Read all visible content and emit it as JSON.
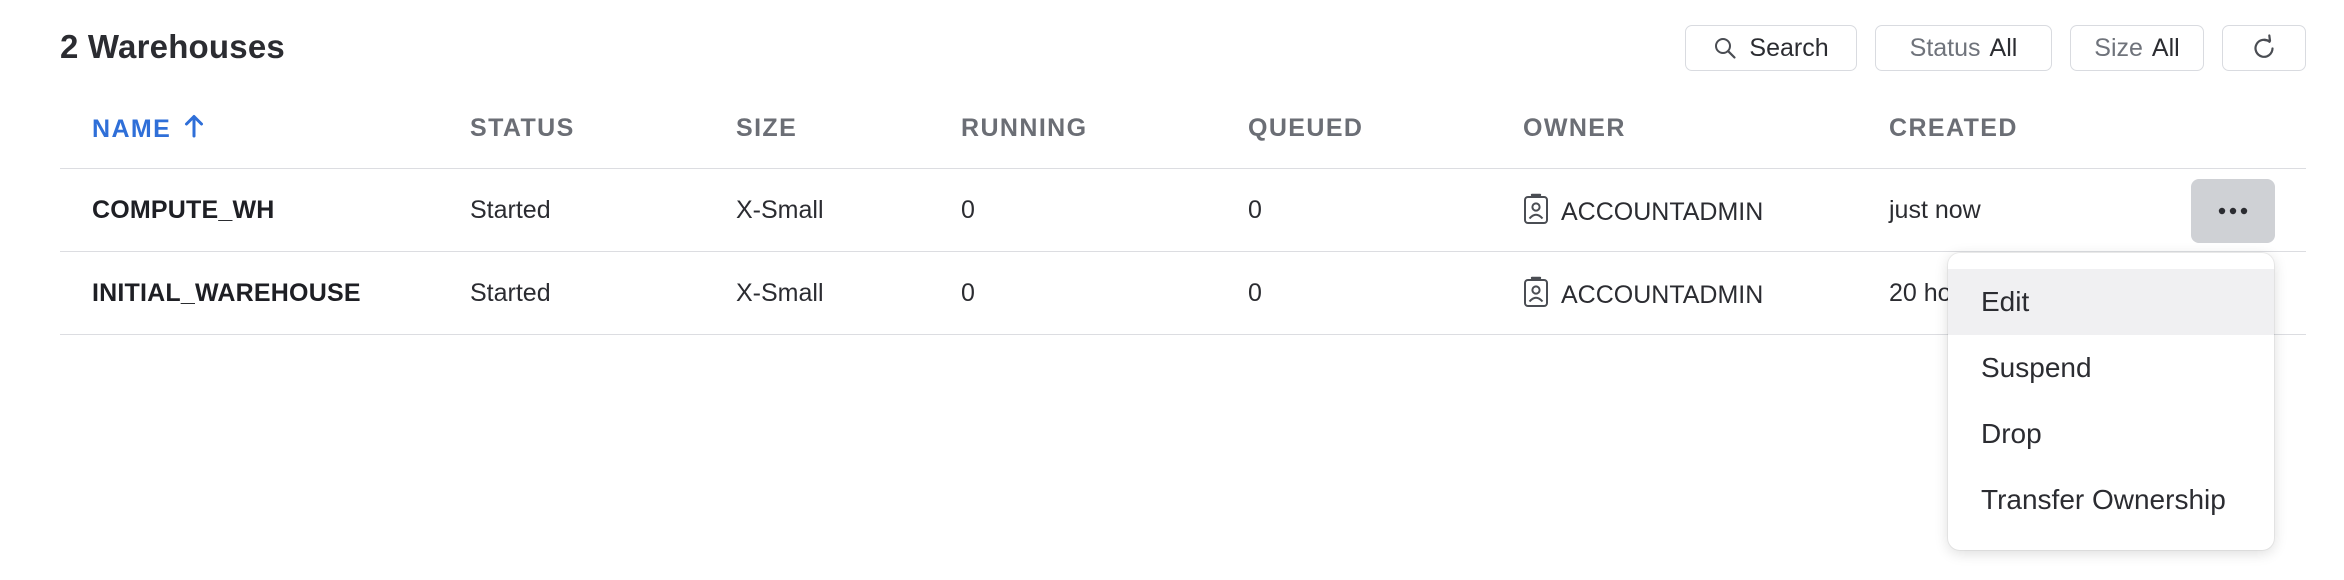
{
  "page": {
    "title": "2 Warehouses"
  },
  "toolbar": {
    "search_label": "Search",
    "status_label": "Status",
    "status_value": "All",
    "size_label": "Size",
    "size_value": "All"
  },
  "table": {
    "headers": {
      "name": "NAME",
      "status": "STATUS",
      "size": "SIZE",
      "running": "RUNNING",
      "queued": "QUEUED",
      "owner": "OWNER",
      "created": "CREATED"
    },
    "sort": {
      "column": "name",
      "direction": "ascending"
    },
    "rows": [
      {
        "name": "COMPUTE_WH",
        "status": "Started",
        "size": "X-Small",
        "running": "0",
        "queued": "0",
        "owner": "ACCOUNTADMIN",
        "created": "just now"
      },
      {
        "name": "INITIAL_WAREHOUSE",
        "status": "Started",
        "size": "X-Small",
        "running": "0",
        "queued": "0",
        "owner": "ACCOUNTADMIN",
        "created": "20 ho"
      }
    ]
  },
  "menu": {
    "items": [
      {
        "label": "Edit"
      },
      {
        "label": "Suspend"
      },
      {
        "label": "Drop"
      },
      {
        "label": "Transfer Ownership"
      }
    ]
  },
  "icons": {
    "search": "search-icon",
    "refresh": "refresh-icon",
    "sort": "arrow-up-icon",
    "owner": "role-badge-icon",
    "more": "ellipsis-icon"
  },
  "colors": {
    "accent": "#2f6fd8",
    "active_button": "#cfd1d5"
  }
}
